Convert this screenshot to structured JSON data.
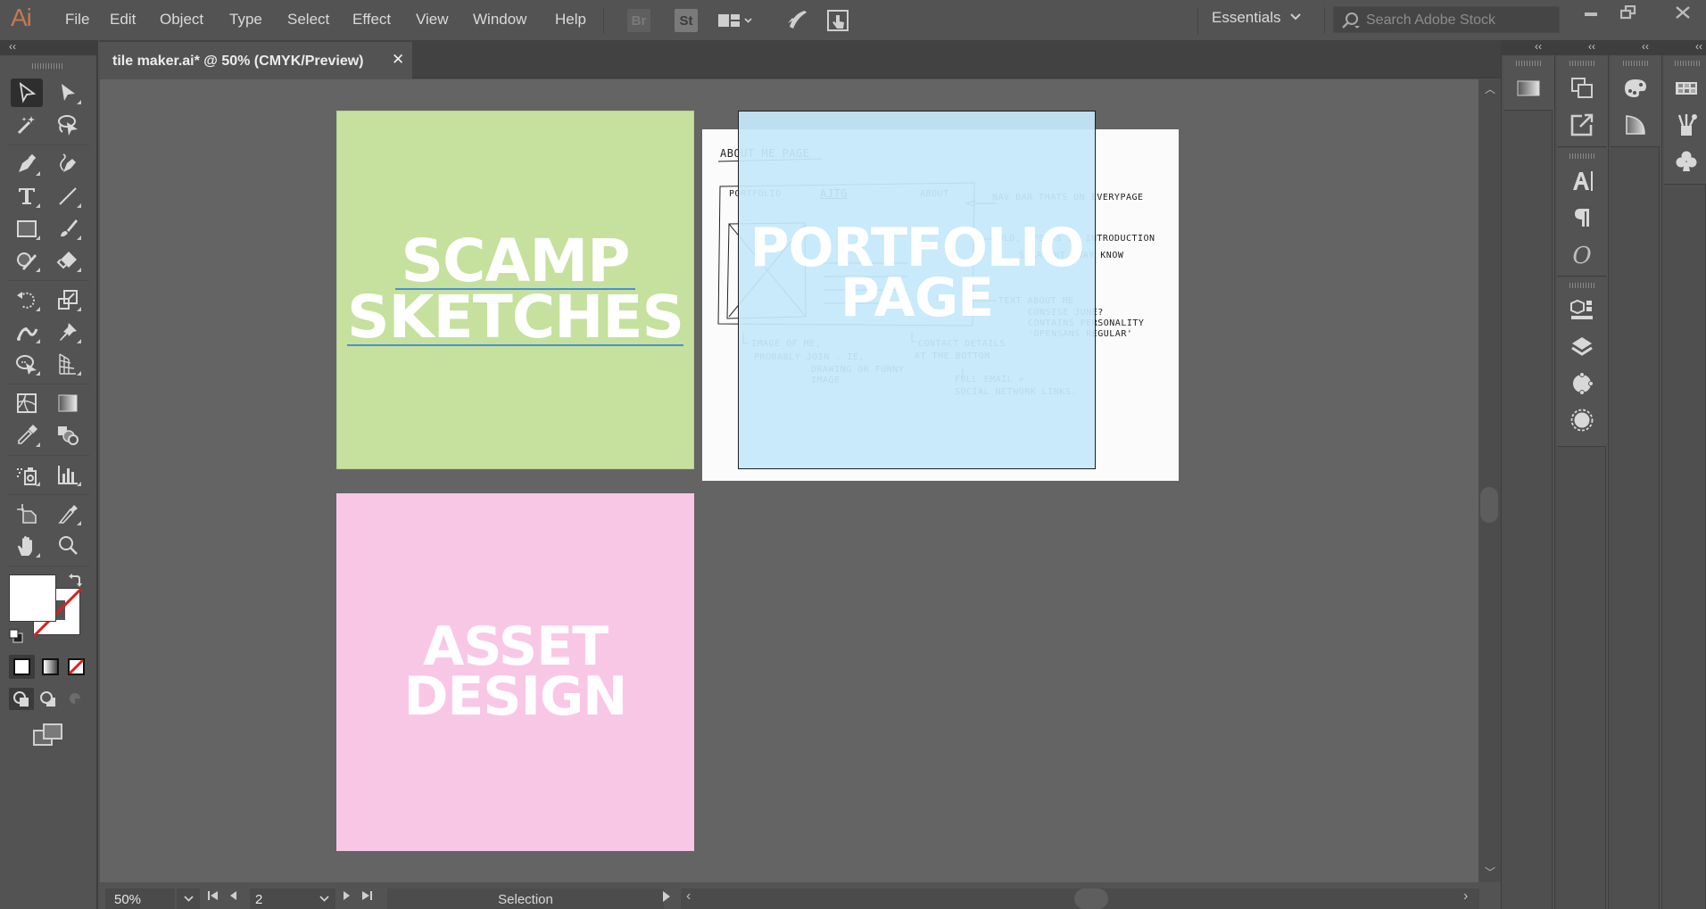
{
  "app": {
    "logo": "Ai",
    "accent_color": "#c7794a"
  },
  "menu": {
    "items": [
      "File",
      "Edit",
      "Object",
      "Type",
      "Select",
      "Effect",
      "View",
      "Window",
      "Help"
    ]
  },
  "toolbar": {
    "bridge_label": "Br",
    "stock_label": "St",
    "workspace_label": "Essentials",
    "search_placeholder": "Search Adobe Stock"
  },
  "document": {
    "tab_title": "tile maker.ai* @ 50% (CMYK/Preview)",
    "close_glyph": "✕"
  },
  "canvas": {
    "tiles": [
      {
        "name": "scamp-sketches",
        "lines": [
          "SCAMP",
          "SKETCHES"
        ],
        "color": "#c5e19d"
      },
      {
        "name": "portfolio-page",
        "lines": [
          "PORTFOLIO",
          "PAGE"
        ],
        "color": "#c4e8fa"
      },
      {
        "name": "asset-design",
        "lines": [
          "ASSET",
          "DESIGN"
        ],
        "color": "#f9c7e6"
      }
    ],
    "sketch_notes": {
      "heading": "ABOUT ME PAGE",
      "nav_left": "PORTFOLIO",
      "nav_center": "AJTG",
      "nav_right": "ABOUT",
      "nav_note": "NAV BAR THATS ON EVERYPAGE",
      "intro_note": "BOLD, SPEAKS IN INTRODUCTION",
      "intro_note2": "STRAIGHT AWAY KNOW",
      "text_note": "TEXT ABOUT ME",
      "text_note2": "CONSISE  JUNE?",
      "text_note3": "CONTAINS PERSONALITY",
      "text_note4": "'OPENSANS REGULAR'",
      "image_note": "IMAGE OF ME,",
      "image_note2": "PROBABLY JOIN . IE,",
      "image_note3": "DRAWING OR FUNNY",
      "image_note4": "IMAGE",
      "contact_note": "CONTACT DETAILS",
      "contact_note2": "AT THE BOTTOM",
      "contact_note3": "FULL EMAIL +",
      "contact_note4": "SOCIAL NETWORK LINKS."
    }
  },
  "statusbar": {
    "zoom": "50%",
    "artboard_number": "2",
    "mode": "Selection"
  },
  "icons": {
    "collapse": "‹‹",
    "chevron_down": "⌄",
    "first": "⏮",
    "prev": "◀",
    "next": "▶",
    "last": "⏭",
    "scroll_left": "‹",
    "scroll_right": "›",
    "scroll_up": "︿",
    "scroll_down": "﹀"
  }
}
